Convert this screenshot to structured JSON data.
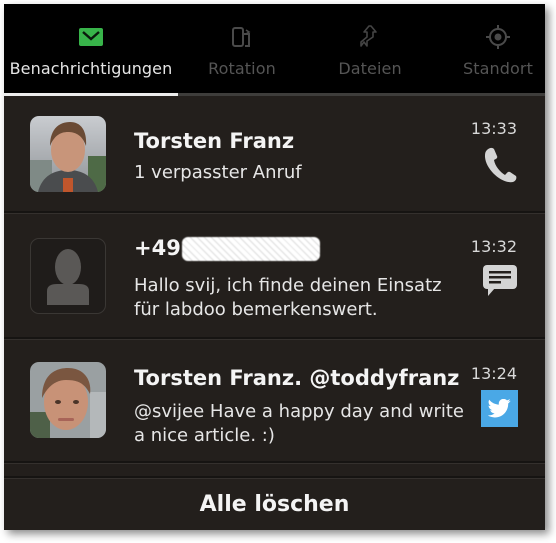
{
  "tabs": [
    {
      "label": "Benachrichtigungen",
      "icon": "envelope-icon",
      "active": true,
      "icon_color": "#38b44a"
    },
    {
      "label": "Rotation",
      "icon": "rotation-lock-icon",
      "active": false
    },
    {
      "label": "Dateien",
      "icon": "transfer-arrows-icon",
      "active": false
    },
    {
      "label": "Standort",
      "icon": "location-target-icon",
      "active": false
    }
  ],
  "notifications": [
    {
      "title": "Torsten Franz",
      "body_lines": [
        "1 verpasster Anruf"
      ],
      "time": "13:33",
      "app_icon": "phone-icon",
      "avatar": "contact-photo"
    },
    {
      "title": "+49",
      "title_redacted": true,
      "body_lines": [
        "Hallo svij, ich finde deinen Einsatz",
        "für labdoo bemerkenswert."
      ],
      "time": "13:32",
      "app_icon": "message-bubble-icon",
      "avatar": "placeholder-person"
    },
    {
      "title": "Torsten Franz. @toddyfranz",
      "body_lines": [
        "@svijee Have a happy day and write",
        "a nice article. :)"
      ],
      "time": "13:24",
      "app_icon": "twitter-icon",
      "app_icon_color": "#4aa8e6",
      "avatar": "contact-photo"
    }
  ],
  "clear_all_label": "Alle löschen"
}
